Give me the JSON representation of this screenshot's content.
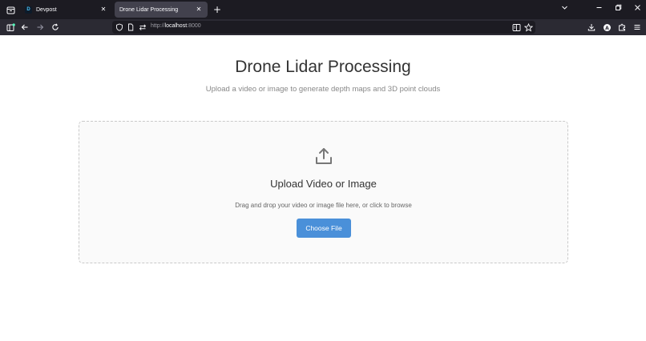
{
  "browser": {
    "tabs": [
      {
        "title": "Devpost",
        "favicon": "D",
        "active": false
      },
      {
        "title": "Drone Lidar Processing",
        "active": true
      }
    ],
    "url": {
      "scheme": "http://",
      "host": "localhost",
      "port": ":8000"
    },
    "icons": {
      "tab_overview": "tab-overview-icon",
      "new_tab": "plus-icon",
      "list_all_tabs": "chevron-down-icon",
      "minimize": "minimize-icon",
      "restore": "restore-icon",
      "close": "close-icon",
      "sidebar": "sidebar-icon",
      "back": "back-arrow-icon",
      "forward": "forward-arrow-icon",
      "reload": "reload-icon",
      "tracking_protection": "shield-icon",
      "page_info": "page-icon",
      "permissions": "permissions-icon",
      "reader_view": "reader-view-icon",
      "bookmark": "star-icon",
      "downloads": "download-icon",
      "account": "account-icon",
      "extensions": "puzzle-icon",
      "menu": "hamburger-menu-icon"
    }
  },
  "page": {
    "title": "Drone Lidar Processing",
    "subtitle": "Upload a video or image to generate depth maps and 3D point clouds",
    "upload": {
      "icon": "upload-icon",
      "heading": "Upload Video or Image",
      "hint": "Drag and drop your video or image file here, or click to browse",
      "button_label": "Choose File"
    }
  },
  "colors": {
    "accent_button": "#4a90d9",
    "chrome_dark": "#1c1b22",
    "toolbar": "#2b2a33",
    "active_tab": "#42414d"
  }
}
